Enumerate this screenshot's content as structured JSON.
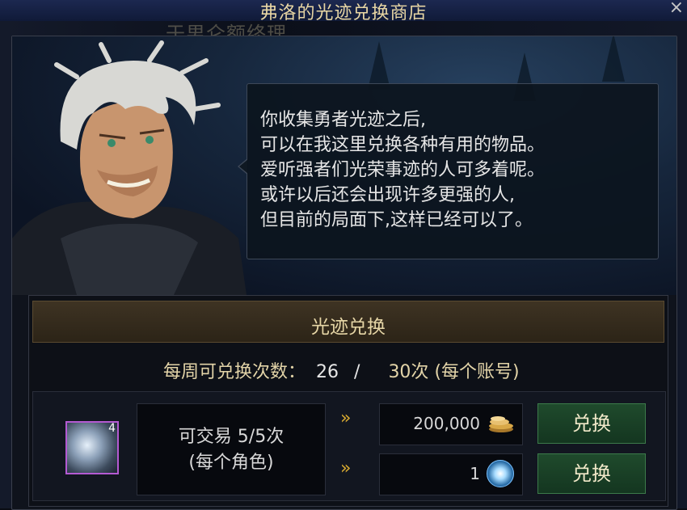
{
  "window": {
    "title": "弗洛的光迹兑换商店",
    "background_text": "于男仑额终理"
  },
  "dialog": {
    "lines": [
      "你收集勇者光迹之后,",
      "可以在我这里兑换各种有用的物品。",
      "爱听强者们光荣事迹的人可多着呢。",
      "或许以后还会出现许多更强的人,",
      "但目前的局面下,这样已经可以了。"
    ]
  },
  "exchange": {
    "header": "光迹兑换",
    "weekly_prefix": "每周可兑换次数：",
    "weekly_current": "26",
    "weekly_sep": "/",
    "weekly_max": "30次",
    "weekly_suffix": "(每个账号)"
  },
  "item": {
    "count": "4",
    "tradable": "可交易 5/5次",
    "per_character": "(每个角色)",
    "border_color": "#b45ad2"
  },
  "costs": [
    {
      "value": "200,000",
      "icon": "gold-coins-icon",
      "button": "兑换",
      "arrow": "»"
    },
    {
      "value": "1",
      "icon": "crystal-icon",
      "button": "兑换",
      "arrow": "»"
    }
  ],
  "close_icon": "×"
}
